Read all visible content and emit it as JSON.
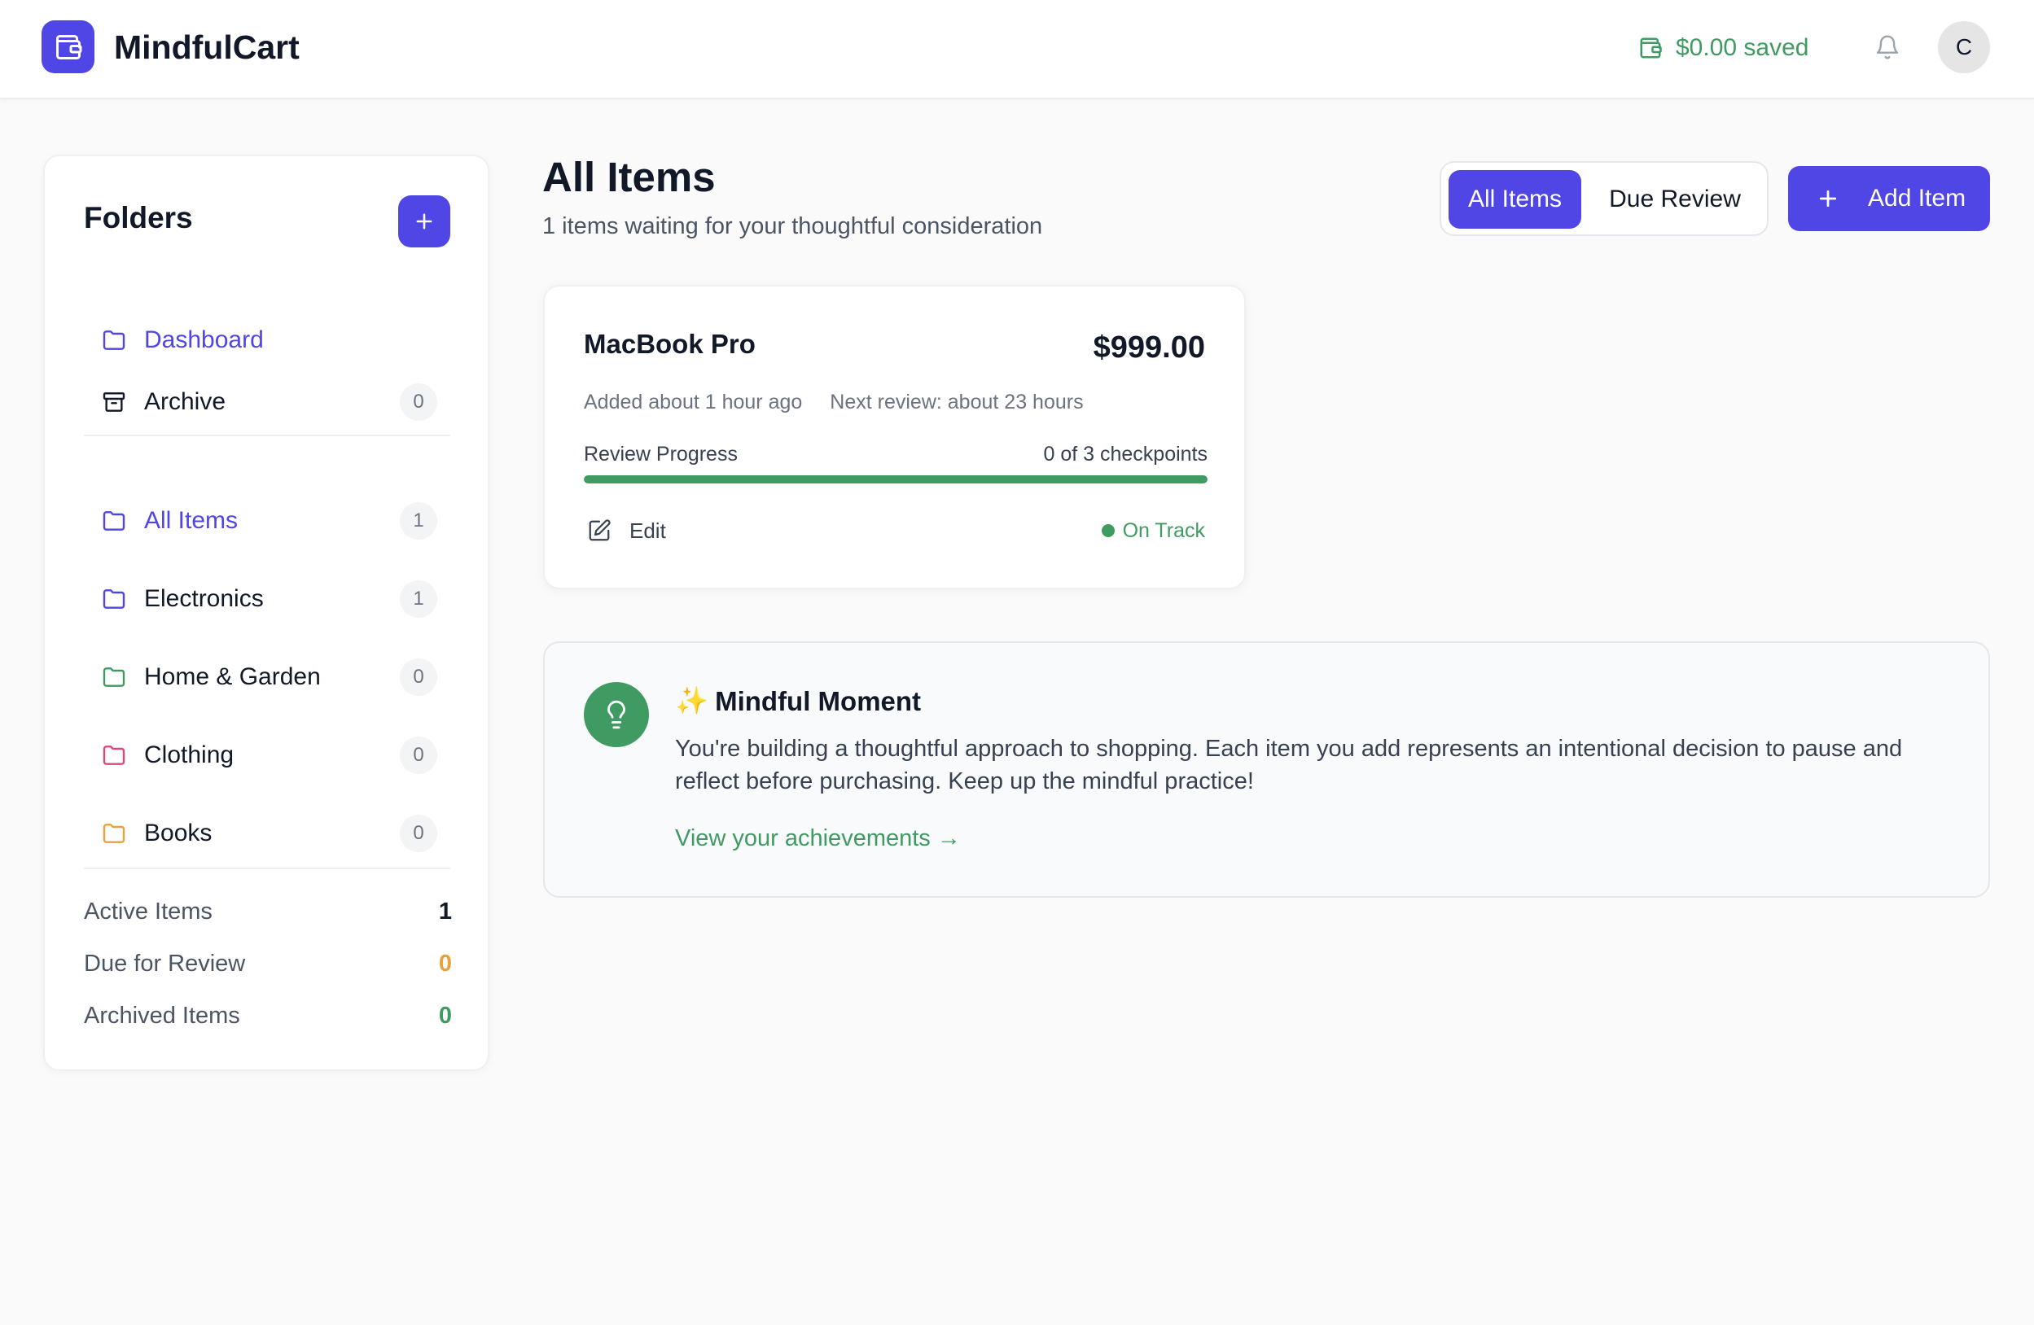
{
  "header": {
    "app_title": "MindfulCart",
    "saved_text": "$0.00 saved",
    "avatar_initial": "C",
    "brand_color": "#4f46e5",
    "saved_color": "#3f9b62"
  },
  "sidebar": {
    "title": "Folders",
    "top_items": [
      {
        "label": "Dashboard",
        "icon": "folder-icon",
        "active": true
      },
      {
        "label": "Archive",
        "icon": "archive-icon",
        "count": "0"
      }
    ],
    "folders": [
      {
        "label": "All Items",
        "count": "1",
        "icon": "folder-icon",
        "color": "#4f46e5",
        "active": true
      },
      {
        "label": "Electronics",
        "count": "1",
        "icon": "folder-icon",
        "color": "#4f46e5"
      },
      {
        "label": "Home & Garden",
        "count": "0",
        "icon": "folder-icon",
        "color": "#3f9b62"
      },
      {
        "label": "Clothing",
        "count": "0",
        "icon": "folder-icon",
        "color": "#e0457b"
      },
      {
        "label": "Books",
        "count": "0",
        "icon": "folder-icon",
        "color": "#e9a23b"
      }
    ],
    "stats": [
      {
        "label": "Active Items",
        "value": "1",
        "color": "#111827"
      },
      {
        "label": "Due for Review",
        "value": "0",
        "color": "#e9a23b"
      },
      {
        "label": "Archived Items",
        "value": "0",
        "color": "#3f9b62"
      }
    ]
  },
  "main": {
    "title": "All Items",
    "subtitle": "1 items waiting for your thoughtful consideration",
    "view_toggle": {
      "all": "All Items",
      "due": "Due Review",
      "selected": "All Items"
    },
    "add_item_label": "Add Item",
    "items": [
      {
        "name": "MacBook Pro",
        "price": "$999.00",
        "added": "Added about 1 hour ago",
        "next_review": "Next review: about 23 hours",
        "progress_label": "Review Progress",
        "progress_text": "0 of 3 checkpoints",
        "progress_fill_percent": 100,
        "edit_label": "Edit",
        "status": "On Track"
      }
    ],
    "moment": {
      "spark": "✨",
      "title": "Mindful Moment",
      "text": "You're building a thoughtful approach to shopping. Each item you add represents an intentional decision to pause and reflect before purchasing. Keep up the mindful practice!",
      "link": "View your achievements →"
    }
  }
}
